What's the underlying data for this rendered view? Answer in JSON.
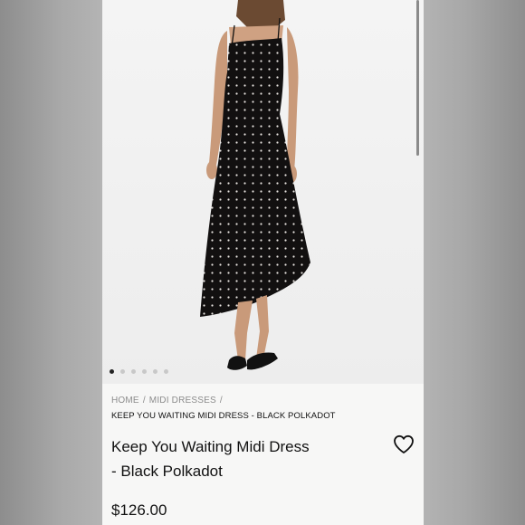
{
  "product_image": {
    "carousel_count": 6,
    "active_index": 0
  },
  "breadcrumb": {
    "items": [
      "HOME",
      "MIDI DRESSES"
    ],
    "separator": "/",
    "current": "KEEP YOU WAITING MIDI DRESS - BLACK POLKADOT"
  },
  "product": {
    "title_line1": "Keep You Waiting Midi Dress",
    "title_line2": "- Black Polkadot",
    "price": "$126.00",
    "wishlist_icon": "heart-outline-icon"
  }
}
